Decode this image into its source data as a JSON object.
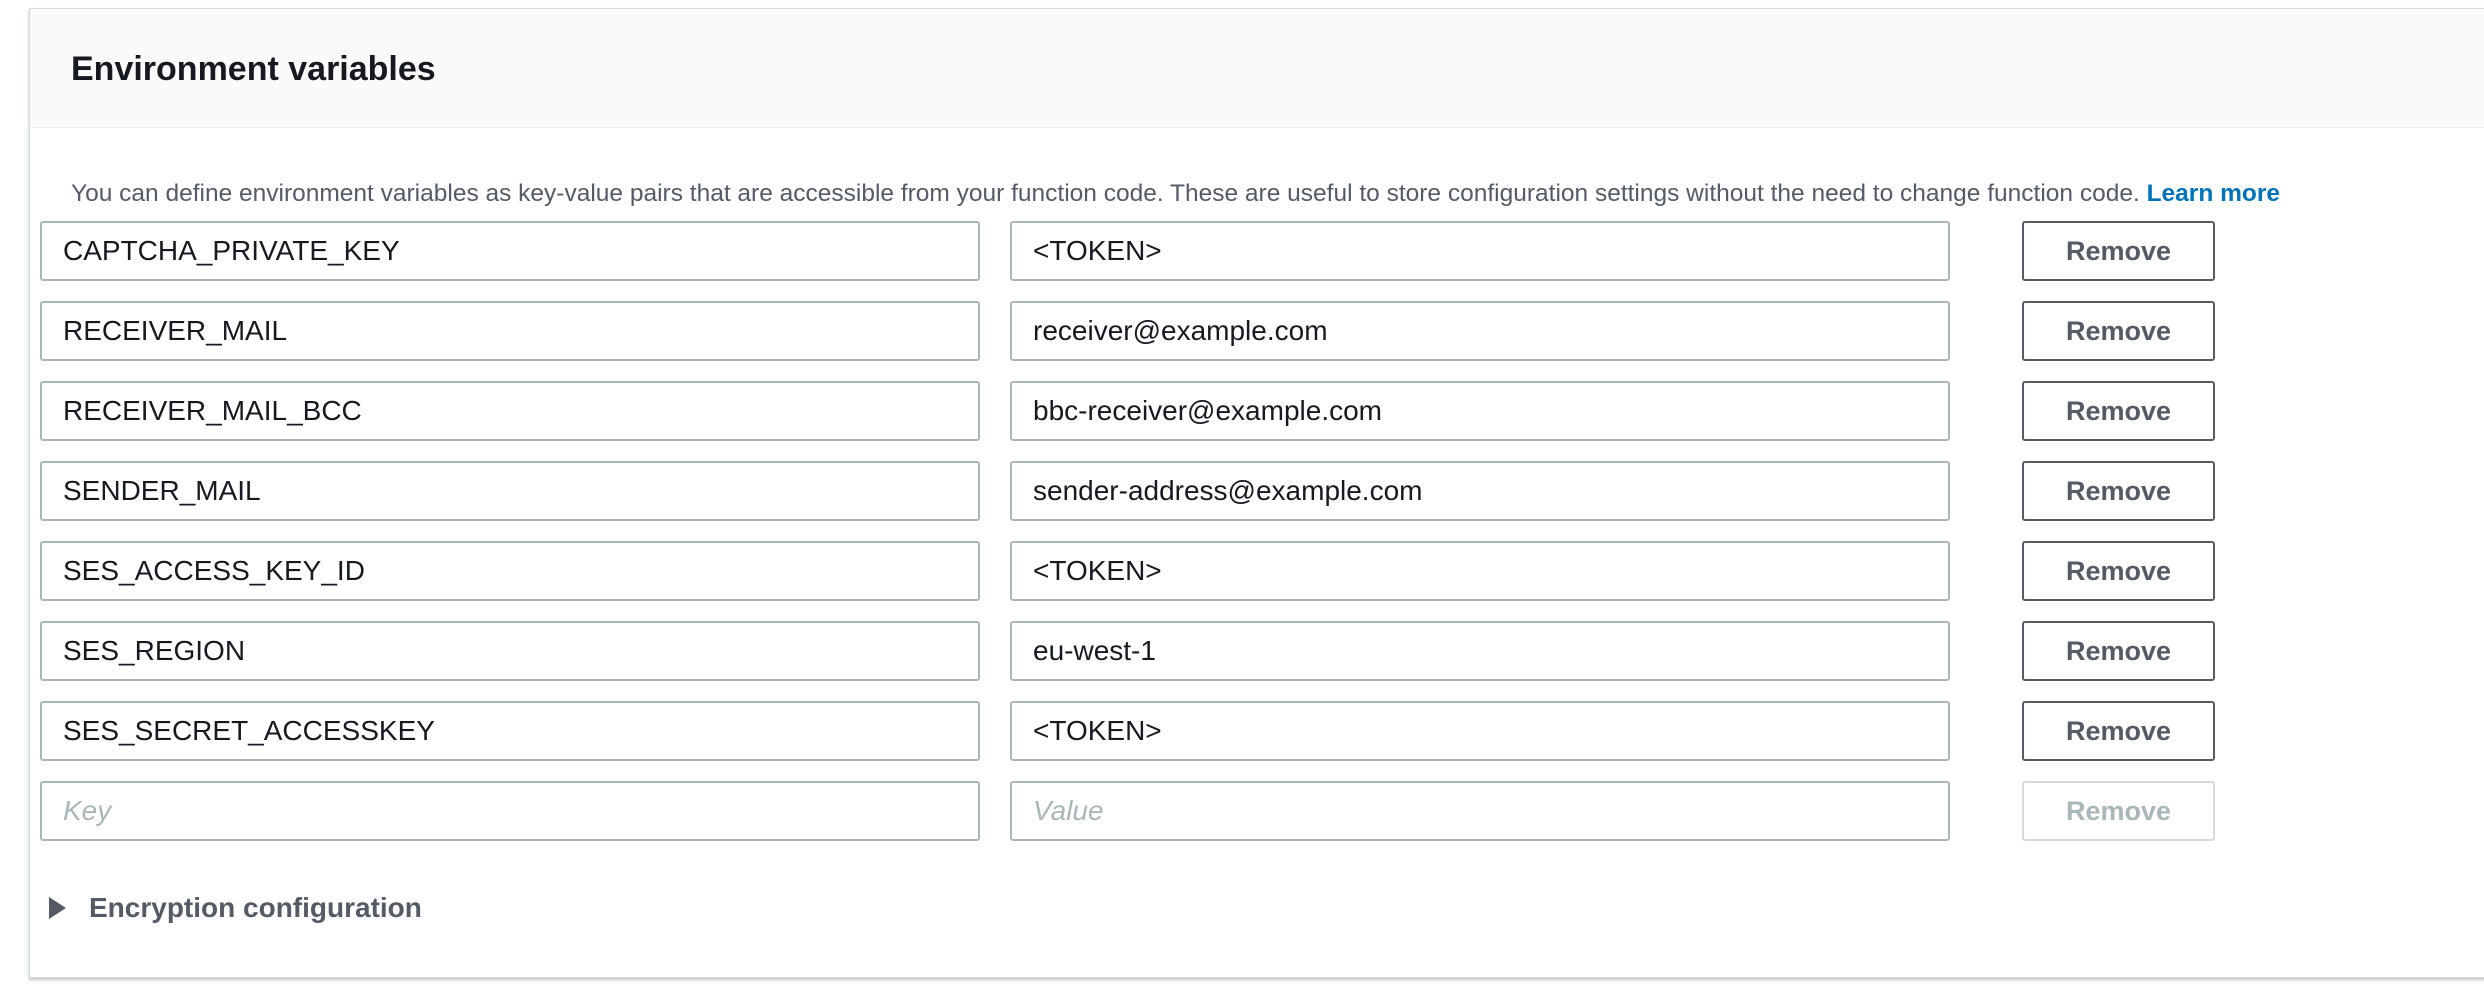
{
  "panel": {
    "title": "Environment variables",
    "description": "You can define environment variables as key-value pairs that are accessible from your function code. These are useful to store configuration settings without the need to change function code.",
    "learn_more": "Learn more"
  },
  "variables": [
    {
      "key": "CAPTCHA_PRIVATE_KEY",
      "value": "<TOKEN>",
      "remove_label": "Remove"
    },
    {
      "key": "RECEIVER_MAIL",
      "value": "receiver@example.com",
      "remove_label": "Remove"
    },
    {
      "key": "RECEIVER_MAIL_BCC",
      "value": "bbc-receiver@example.com",
      "remove_label": "Remove"
    },
    {
      "key": "SENDER_MAIL",
      "value": "sender-address@example.com",
      "remove_label": "Remove"
    },
    {
      "key": "SES_ACCESS_KEY_ID",
      "value": "<TOKEN>",
      "remove_label": "Remove"
    },
    {
      "key": "SES_REGION",
      "value": "eu-west-1",
      "remove_label": "Remove"
    },
    {
      "key": "SES_SECRET_ACCESSKEY",
      "value": "<TOKEN>",
      "remove_label": "Remove"
    }
  ],
  "new_variable": {
    "key_placeholder": "Key",
    "value_placeholder": "Value",
    "remove_label": "Remove"
  },
  "encryption": {
    "label": "Encryption configuration",
    "icon": "caret-right-icon"
  },
  "colors": {
    "link": "#0073bb",
    "text_secondary": "#545b64",
    "border": "#aab7b8"
  }
}
